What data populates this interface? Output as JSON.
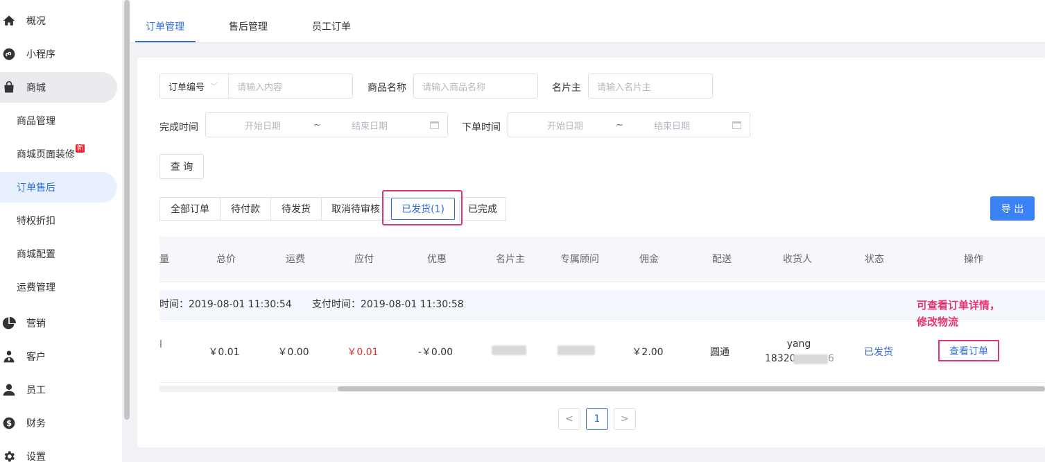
{
  "sidebar": {
    "items": [
      {
        "label": "概况",
        "icon": "home-icon"
      },
      {
        "label": "小程序",
        "icon": "miniprogram-icon"
      },
      {
        "label": "商城",
        "icon": "shopping-bag-icon"
      },
      {
        "label": "商品管理"
      },
      {
        "label": "商城页面装修",
        "badge": "新"
      },
      {
        "label": "订单售后"
      },
      {
        "label": "特权折扣"
      },
      {
        "label": "商城配置"
      },
      {
        "label": "运费管理"
      },
      {
        "label": "营销",
        "icon": "pie-chart-icon"
      },
      {
        "label": "客户",
        "icon": "customer-icon"
      },
      {
        "label": "员工",
        "icon": "user-icon"
      },
      {
        "label": "财务",
        "icon": "dollar-icon"
      },
      {
        "label": "设置",
        "icon": "gear-icon"
      }
    ]
  },
  "tabs": [
    "订单管理",
    "售后管理",
    "员工订单"
  ],
  "filters": {
    "order_select": "订单编号",
    "content_placeholder": "请输入内容",
    "product_label": "商品名称",
    "product_placeholder": "请输入商品名称",
    "card_label": "名片主",
    "card_placeholder": "请输入名片主",
    "finish_label": "完成时间",
    "place_label": "下单时间",
    "start_date": "开始日期",
    "end_date": "结束日期",
    "tilde": "~",
    "query_btn": "查 询"
  },
  "status_tabs": [
    "全部订单",
    "待付款",
    "待发货",
    "取消待审核",
    "已发货(1)",
    "已完成"
  ],
  "export_btn": "导 出",
  "columns": [
    "量",
    "总价",
    "运费",
    "应付",
    "优惠",
    "名片主",
    "专属顾问",
    "佣金",
    "配送",
    "收货人",
    "状态",
    "操作"
  ],
  "order": {
    "create_time": "时间：2019-08-01 11:30:54",
    "pay_time": "支付时间：2019-08-01 11:30:58",
    "row_prefix": "l",
    "total": "￥0.01",
    "shipping": "￥0.00",
    "payable": "￥0.01",
    "discount": "-￥0.00",
    "commission": "￥2.00",
    "delivery": "圆通",
    "receiver_name": "yang",
    "receiver_phone_prefix": "18320",
    "receiver_phone_suffix": "6",
    "status": "已发货",
    "action": "查看订单"
  },
  "annotation": [
    "可查看订单详情，",
    "修改物流"
  ],
  "pagination": {
    "prev": "<",
    "current": "1",
    "next": ">"
  },
  "colors": {
    "primary": "#2f6ed8",
    "highlight": "#e8336d",
    "price_red": "#e02f2f",
    "export": "#3b82f6"
  }
}
